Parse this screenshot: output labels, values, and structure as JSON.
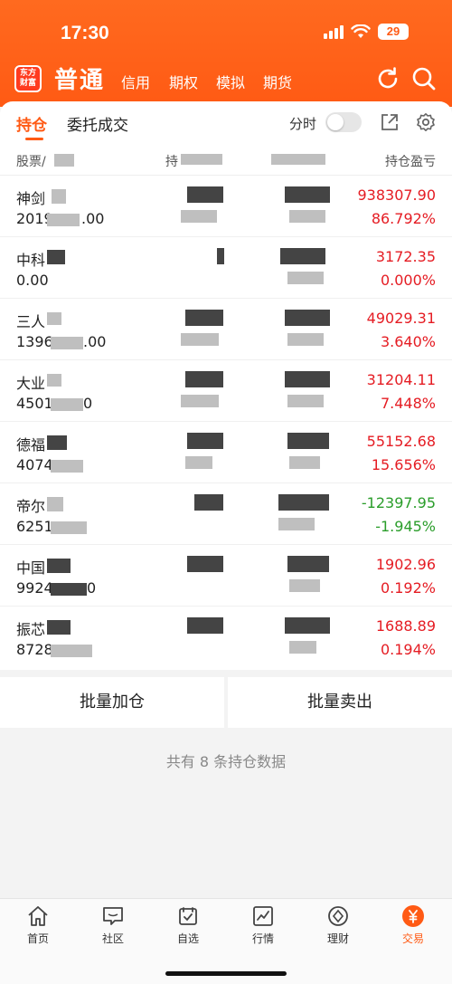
{
  "status_bar": {
    "time": "17:30",
    "battery": "29"
  },
  "header": {
    "logo_text": "东方财富",
    "main_label": "普通",
    "sub_tabs": [
      "信用",
      "期权",
      "模拟",
      "期货"
    ]
  },
  "tabs": {
    "active": "持仓",
    "other": "委托成交",
    "fenshi_label": "分时"
  },
  "table": {
    "headers": [
      "股票/",
      "持",
      "",
      "持仓盈亏"
    ],
    "rows": [
      {
        "name": "神剑",
        "qty": "2019",
        "qty_tail": ".00",
        "pl": "938307.90",
        "pct": "86.792%",
        "trend": "up"
      },
      {
        "name": "中科",
        "qty": "0.00",
        "qty_tail": "",
        "pl": "3172.35",
        "pct": "0.000%",
        "trend": "up"
      },
      {
        "name": "三人",
        "qty": "1396",
        "qty_tail": ".00",
        "pl": "49029.31",
        "pct": "3.640%",
        "trend": "up"
      },
      {
        "name": "大业",
        "qty": "4501",
        "qty_tail": "0",
        "pl": "31204.11",
        "pct": "7.448%",
        "trend": "up"
      },
      {
        "name": "德福",
        "qty": "4074",
        "qty_tail": "",
        "pl": "55152.68",
        "pct": "15.656%",
        "trend": "up"
      },
      {
        "name": "帝尔",
        "qty": "6251",
        "qty_tail": "",
        "pl": "-12397.95",
        "pct": "-1.945%",
        "trend": "down"
      },
      {
        "name": "中国",
        "qty": "9924",
        "qty_tail": "0",
        "pl": "1902.96",
        "pct": "0.192%",
        "trend": "up"
      },
      {
        "name": "振芯",
        "qty": "8728",
        "qty_tail": "",
        "pl": "1688.89",
        "pct": "0.194%",
        "trend": "up"
      }
    ]
  },
  "actions": {
    "batch_add": "批量加仓",
    "batch_sell": "批量卖出"
  },
  "summary": "共有 8 条持仓数据",
  "bottom_nav": [
    "首页",
    "社区",
    "自选",
    "行情",
    "理财",
    "交易"
  ],
  "colors": {
    "accent": "#ff5a14",
    "profit": "#e51c23",
    "loss": "#2a9d2a"
  }
}
